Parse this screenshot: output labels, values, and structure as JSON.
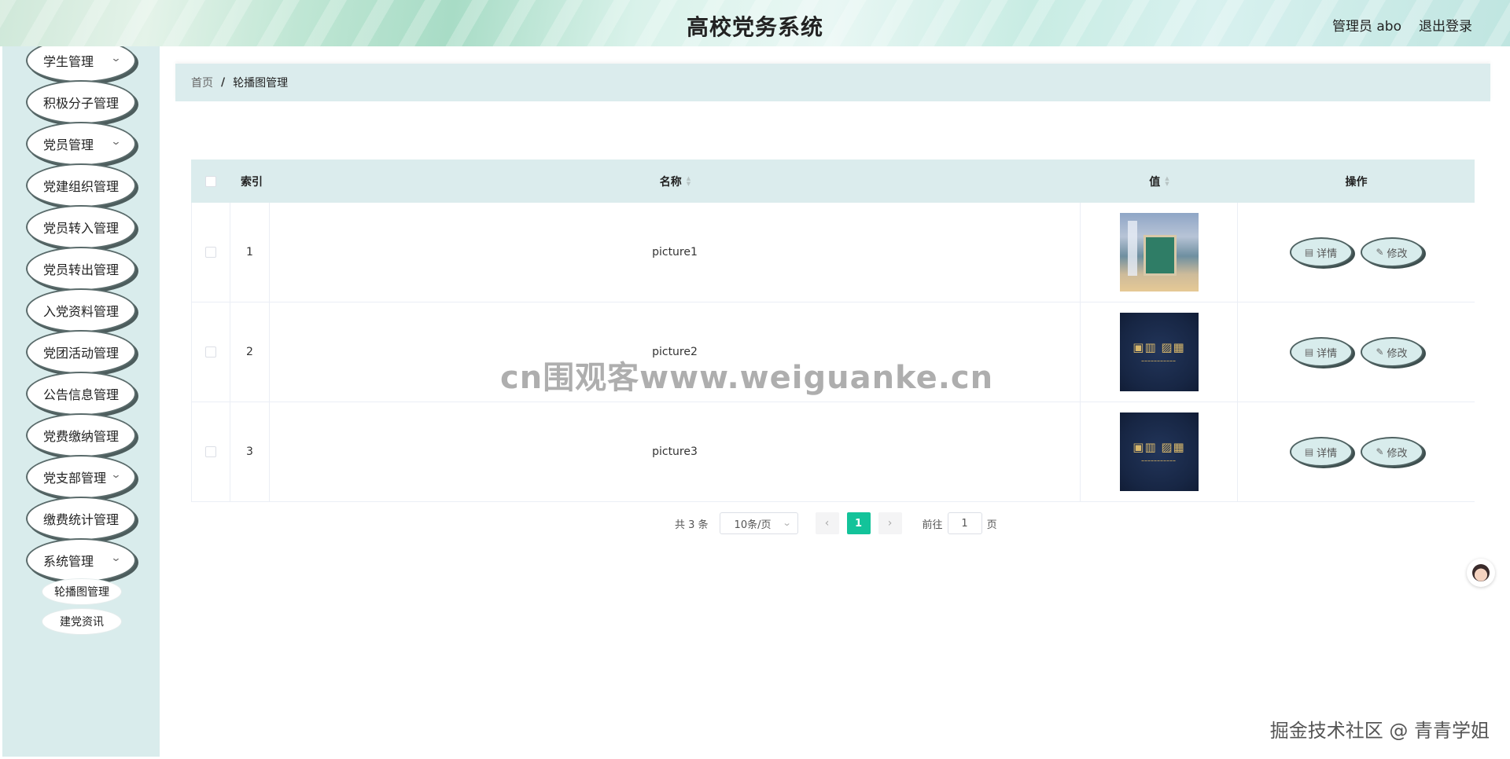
{
  "header": {
    "title": "高校党务系统",
    "user": "管理员 abo",
    "logout": "退出登录"
  },
  "sidebar": {
    "items": [
      {
        "label": "学生管理",
        "expandable": true
      },
      {
        "label": "积极分子管理",
        "expandable": false
      },
      {
        "label": "党员管理",
        "expandable": true
      },
      {
        "label": "党建组织管理",
        "expandable": false
      },
      {
        "label": "党员转入管理",
        "expandable": false
      },
      {
        "label": "党员转出管理",
        "expandable": false
      },
      {
        "label": "入党资料管理",
        "expandable": false
      },
      {
        "label": "党团活动管理",
        "expandable": false
      },
      {
        "label": "公告信息管理",
        "expandable": false
      },
      {
        "label": "党费缴纳管理",
        "expandable": false
      },
      {
        "label": "党支部管理",
        "expandable": true
      },
      {
        "label": "缴费统计管理",
        "expandable": false
      },
      {
        "label": "系统管理",
        "expandable": true
      }
    ],
    "sub_items": [
      "轮播图管理",
      "建党资讯"
    ]
  },
  "breadcrumb": {
    "home": "首页",
    "separator": "/",
    "current": "轮播图管理"
  },
  "table": {
    "headers": {
      "index": "索引",
      "name": "名称",
      "value": "值",
      "ops": "操作"
    },
    "rows": [
      {
        "index": "1",
        "name": "picture1",
        "image": "classroom-image"
      },
      {
        "index": "2",
        "name": "picture2",
        "image": "logo-image"
      },
      {
        "index": "3",
        "name": "picture3",
        "image": "logo-image"
      }
    ],
    "detail_label": "详情",
    "edit_label": "修改"
  },
  "pagination": {
    "total": "共 3 条",
    "page_size": "10条/页",
    "current_page": "1",
    "goto_label": "前往",
    "goto_value": "1",
    "page_unit": "页"
  },
  "watermark": "cn围观客www.weiguanke.cn",
  "corner_mark": "掘金技术社区 @ 青青学姐",
  "colors": {
    "accent": "#13c39a",
    "panel": "#dbeced",
    "sidebar": "#d9ecec"
  }
}
